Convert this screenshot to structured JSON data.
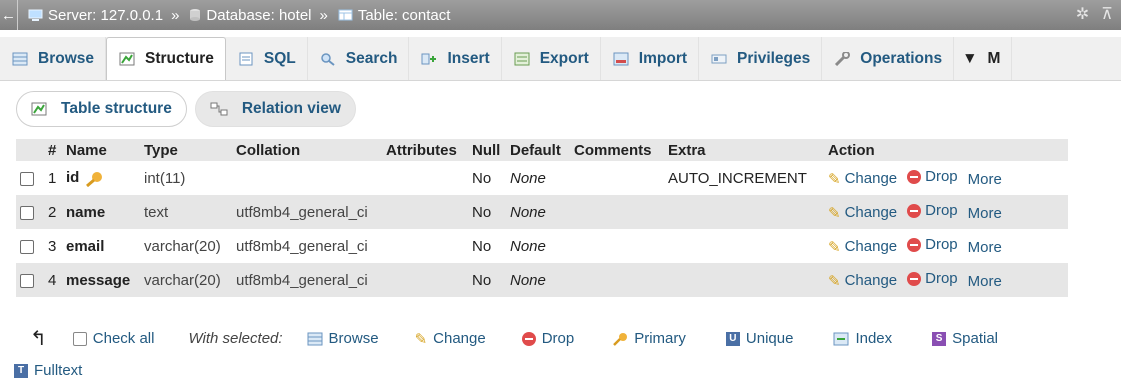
{
  "breadcrumb": {
    "back_icon": "arrow-left-icon",
    "server_label": "Server: 127.0.0.1",
    "database_label": "Database: hotel",
    "table_label": "Table: contact",
    "separator": "»"
  },
  "tabs": [
    {
      "label": "Browse",
      "icon": "browse-icon",
      "active": false
    },
    {
      "label": "Structure",
      "icon": "structure-icon",
      "active": true
    },
    {
      "label": "SQL",
      "icon": "sql-icon",
      "active": false
    },
    {
      "label": "Search",
      "icon": "search-icon",
      "active": false
    },
    {
      "label": "Insert",
      "icon": "insert-icon",
      "active": false
    },
    {
      "label": "Export",
      "icon": "export-icon",
      "active": false
    },
    {
      "label": "Import",
      "icon": "import-icon",
      "active": false
    },
    {
      "label": "Privileges",
      "icon": "privileges-icon",
      "active": false
    },
    {
      "label": "Operations",
      "icon": "operations-icon",
      "active": false
    }
  ],
  "tab_more_label": "M",
  "subtabs": {
    "table_structure": "Table structure",
    "relation_view": "Relation view"
  },
  "columns": {
    "num": "#",
    "name": "Name",
    "type": "Type",
    "collation": "Collation",
    "attributes": "Attributes",
    "null": "Null",
    "default": "Default",
    "comments": "Comments",
    "extra": "Extra",
    "action": "Action"
  },
  "rows": [
    {
      "num": "1",
      "name": "id",
      "type": "int(11)",
      "collation": "",
      "attributes": "",
      "null": "No",
      "default": "None",
      "comments": "",
      "extra": "AUTO_INCREMENT",
      "primary_key": true
    },
    {
      "num": "2",
      "name": "name",
      "type": "text",
      "collation": "utf8mb4_general_ci",
      "attributes": "",
      "null": "No",
      "default": "None",
      "comments": "",
      "extra": "",
      "primary_key": false
    },
    {
      "num": "3",
      "name": "email",
      "type": "varchar(20)",
      "collation": "utf8mb4_general_ci",
      "attributes": "",
      "null": "No",
      "default": "None",
      "comments": "",
      "extra": "",
      "primary_key": false
    },
    {
      "num": "4",
      "name": "message",
      "type": "varchar(20)",
      "collation": "utf8mb4_general_ci",
      "attributes": "",
      "null": "No",
      "default": "None",
      "comments": "",
      "extra": "",
      "primary_key": false
    }
  ],
  "row_actions": {
    "change": "Change",
    "drop": "Drop",
    "more": "More"
  },
  "bottom": {
    "check_all": "Check all",
    "with_selected": "With selected:",
    "browse": "Browse",
    "change": "Change",
    "drop": "Drop",
    "primary": "Primary",
    "unique": "Unique",
    "index": "Index",
    "spatial": "Spatial",
    "fulltext": "Fulltext"
  },
  "colors": {
    "link": "#235a81",
    "drop": "#e04b4b",
    "header_bg": "#e7e7e7",
    "even_row": "#e6e6e6"
  }
}
